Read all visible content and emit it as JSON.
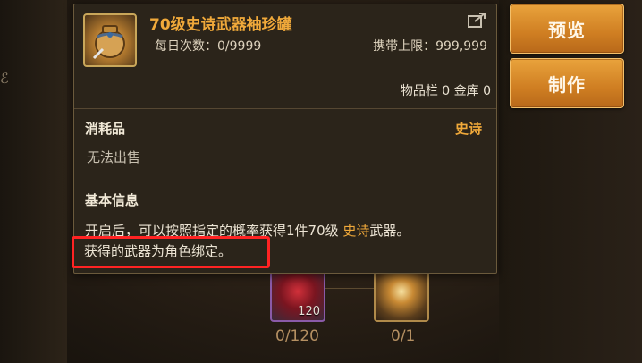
{
  "side_buttons": {
    "preview": "预览",
    "craft": "制作"
  },
  "materials": [
    {
      "count": "120",
      "progress": "0/120"
    },
    {
      "count": "",
      "progress": "0/1"
    }
  ],
  "tooltip": {
    "item_name": "70级史诗武器袖珍罐",
    "daily_uses": "每日次数：0/9999",
    "carry_limit": "携带上限：999,999",
    "storage": "物品栏 0 金库 0",
    "category": "消耗品",
    "rarity": "史诗",
    "sell_status": "无法出售",
    "basic_info_title": "基本信息",
    "desc_prefix": "开启后，可以按照指定的概率获得1件70级 ",
    "desc_highlight": "史诗",
    "desc_suffix": "武器。",
    "desc_bound": "获得的武器为角色绑定。"
  },
  "colors": {
    "rarity_epic": "#f0a93a",
    "button_orange": "#e9a33c",
    "highlight_box": "#ff2323"
  },
  "icons": [
    "pouch-jar-icon",
    "share-icon",
    "purple-material-icon",
    "gold-emblem-icon"
  ]
}
